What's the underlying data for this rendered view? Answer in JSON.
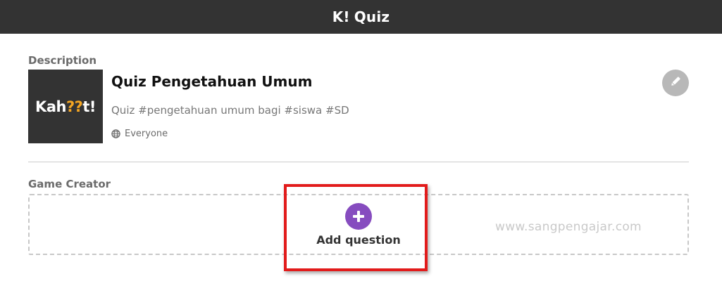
{
  "header": {
    "logo_mark": "K!",
    "title": "Quiz"
  },
  "description": {
    "section_label": "Description",
    "cover_wordmark": [
      "Kah",
      "??",
      "t!"
    ],
    "quiz_title": "Quiz Pengetahuan Umum",
    "quiz_description": "Quiz #pengetahuan umum bagi #siswa #SD",
    "visibility_icon": "globe-icon",
    "visibility": "Everyone",
    "edit_icon": "pencil-icon"
  },
  "game_creator": {
    "section_label": "Game Creator",
    "add_icon": "plus-icon",
    "add_label": "Add question"
  },
  "watermark": "www.sangpengajar.com",
  "colors": {
    "topbar": "#333333",
    "accent_purple": "#864cbf",
    "highlight_red": "#e21b1b",
    "wordmark_orange": "#f5a623"
  }
}
